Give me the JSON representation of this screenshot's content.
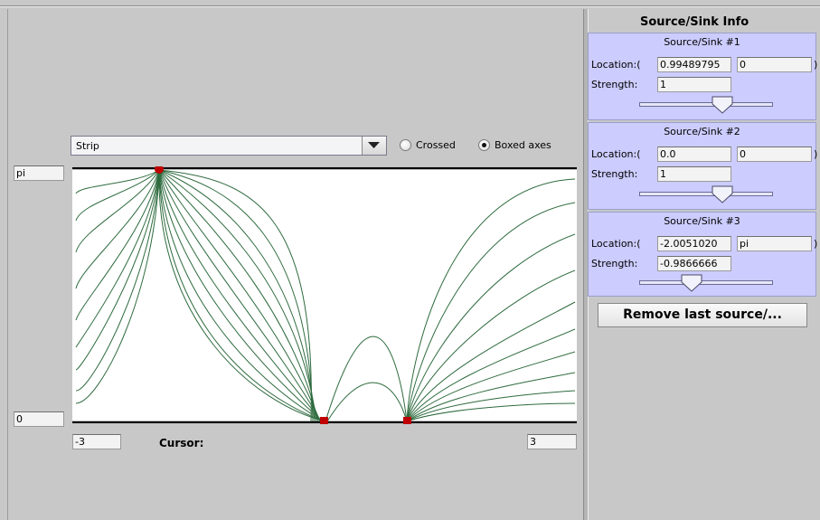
{
  "plot_controls": {
    "combo_value": "Strip",
    "radio_crossed": "Crossed",
    "radio_boxed": "Boxed axes",
    "selected": "Boxed axes"
  },
  "plot_bounds": {
    "y_max": "pi",
    "y_min": "0",
    "x_min": "-3",
    "x_max": "3"
  },
  "cursor_label": "Cursor:",
  "colors": {
    "field_line": "#2e6b3e",
    "marker": "#c00000",
    "panel": "#ccccff",
    "background": "#c8c8c8"
  },
  "info": {
    "title": "Source/Sink Info",
    "location_label": "Location:(",
    "strength_label": "Strength:",
    "close_paren": ")",
    "sources": [
      {
        "title": "Source/Sink #1",
        "x": "0.99489795",
        "y": "0",
        "strength": "1",
        "slider_fraction": 0.7
      },
      {
        "title": "Source/Sink #2",
        "x": "0.0",
        "y": "0",
        "strength": "1",
        "slider_fraction": 0.7
      },
      {
        "title": "Source/Sink #3",
        "x": "-2.0051020",
        "y": "pi",
        "strength": "-0.9866666",
        "slider_fraction": 0.4
      }
    ]
  },
  "remove_button": "Remove last source/..."
}
